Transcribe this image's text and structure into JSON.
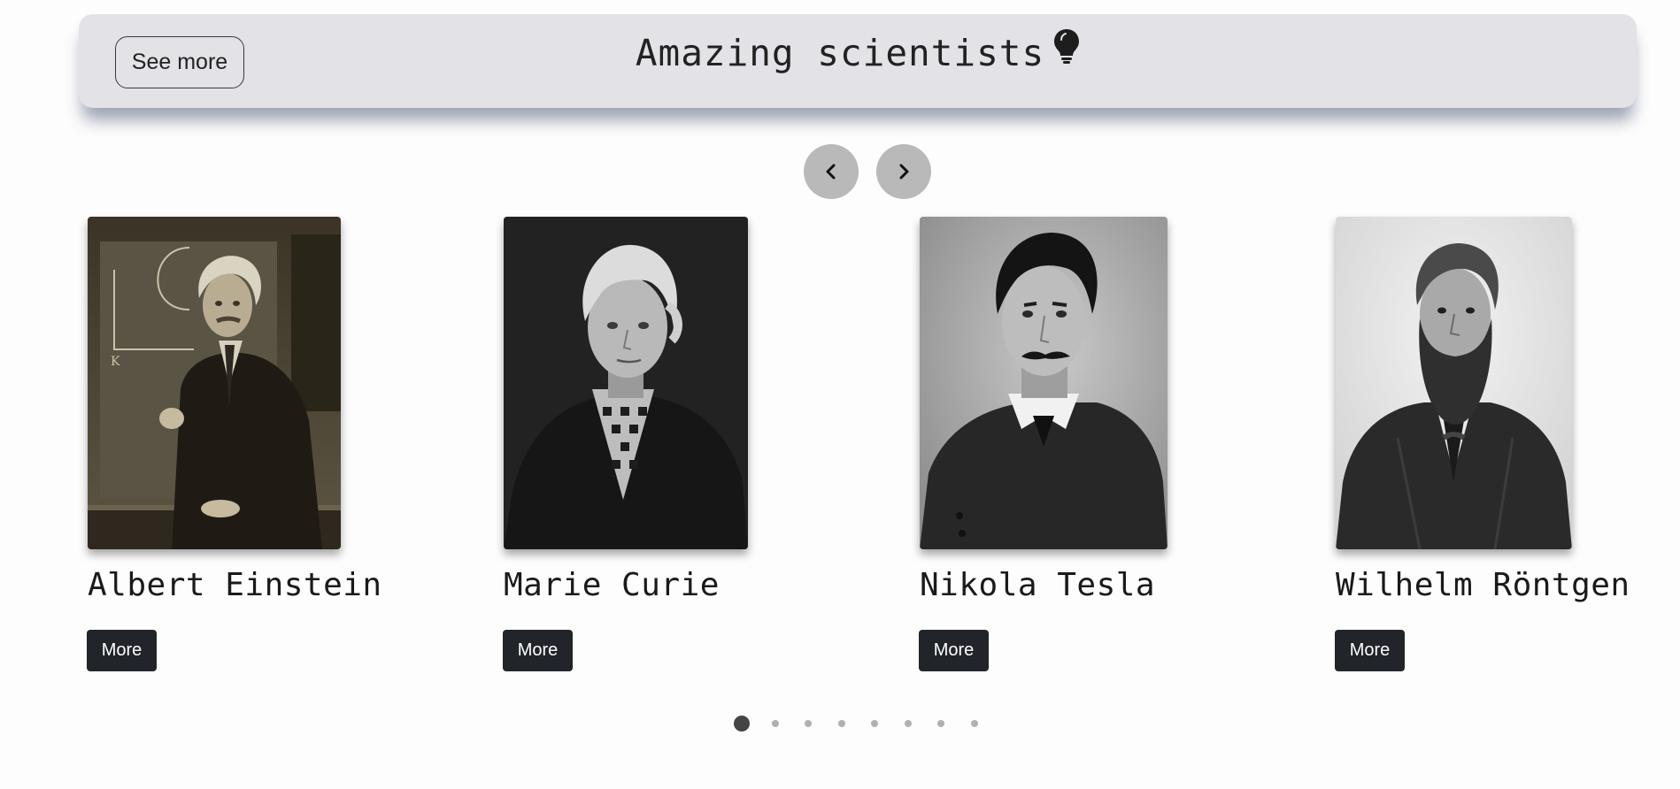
{
  "header": {
    "title": "Amazing scientists",
    "title_icon": "lightbulb-icon",
    "see_more_label": "See more"
  },
  "nav": {
    "prev_icon": "chevron-left-icon",
    "next_icon": "chevron-right-icon"
  },
  "cards": [
    {
      "name": "Albert Einstein",
      "button_label": "More",
      "photo": "portrait-einstein"
    },
    {
      "name": "Marie Curie",
      "button_label": "More",
      "photo": "portrait-curie"
    },
    {
      "name": "Nikola Tesla",
      "button_label": "More",
      "photo": "portrait-tesla"
    },
    {
      "name": "Wilhelm Röntgen",
      "button_label": "More",
      "photo": "portrait-rontgen"
    }
  ],
  "pagination": {
    "total": 8,
    "active_index": 0
  },
  "colors": {
    "banner_bg": "#e2e2e7",
    "button_dark": "#212529",
    "nav_bg": "#b9b9b9",
    "dot_active": "#444444",
    "dot_inactive": "#b0b0b0"
  }
}
